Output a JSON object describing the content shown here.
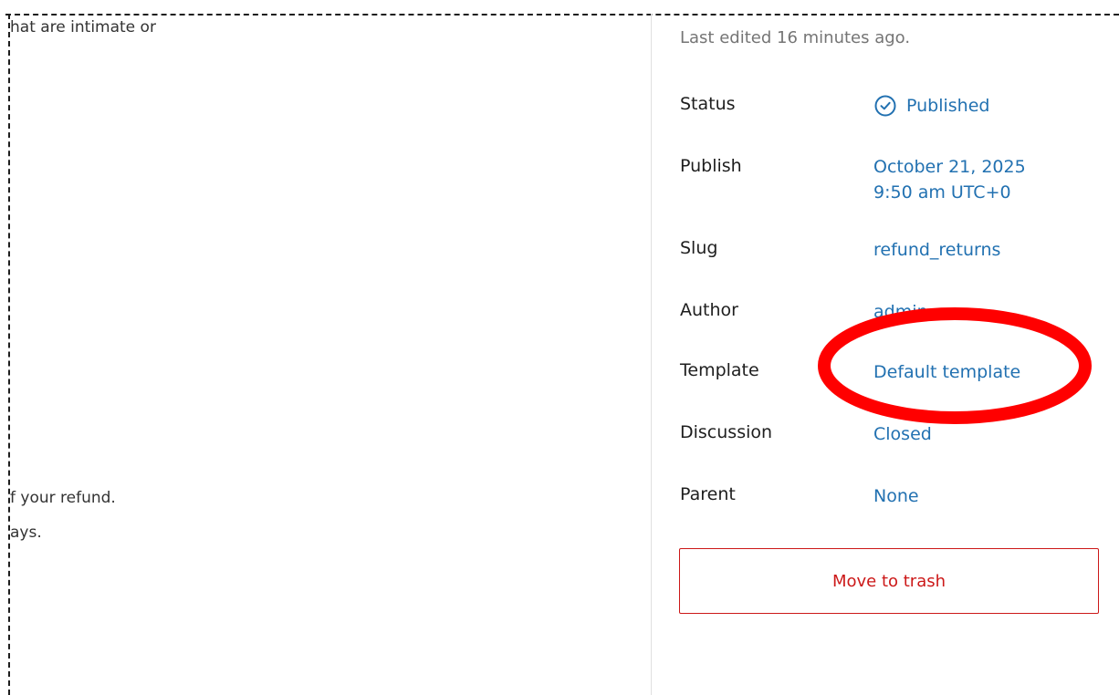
{
  "editor": {
    "content_lines": [
      "hat are intimate or",
      "f your refund.",
      "ays."
    ]
  },
  "sidebar": {
    "last_edited": "Last edited 16 minutes ago.",
    "status": {
      "label": "Status",
      "value": "Published",
      "icon": "check-circle-icon"
    },
    "publish": {
      "label": "Publish",
      "date": "October 21, 2025",
      "time": "9:50 am UTC+0"
    },
    "slug": {
      "label": "Slug",
      "value": "refund_returns"
    },
    "author": {
      "label": "Author",
      "value": "admin"
    },
    "template": {
      "label": "Template",
      "value": "Default template"
    },
    "discussion": {
      "label": "Discussion",
      "value": "Closed"
    },
    "parent": {
      "label": "Parent",
      "value": "None"
    },
    "trash_button": "Move to trash"
  },
  "colors": {
    "link": "#2271b1",
    "danger": "#cc1818",
    "annotation": "#ff0000",
    "muted": "#757575"
  }
}
